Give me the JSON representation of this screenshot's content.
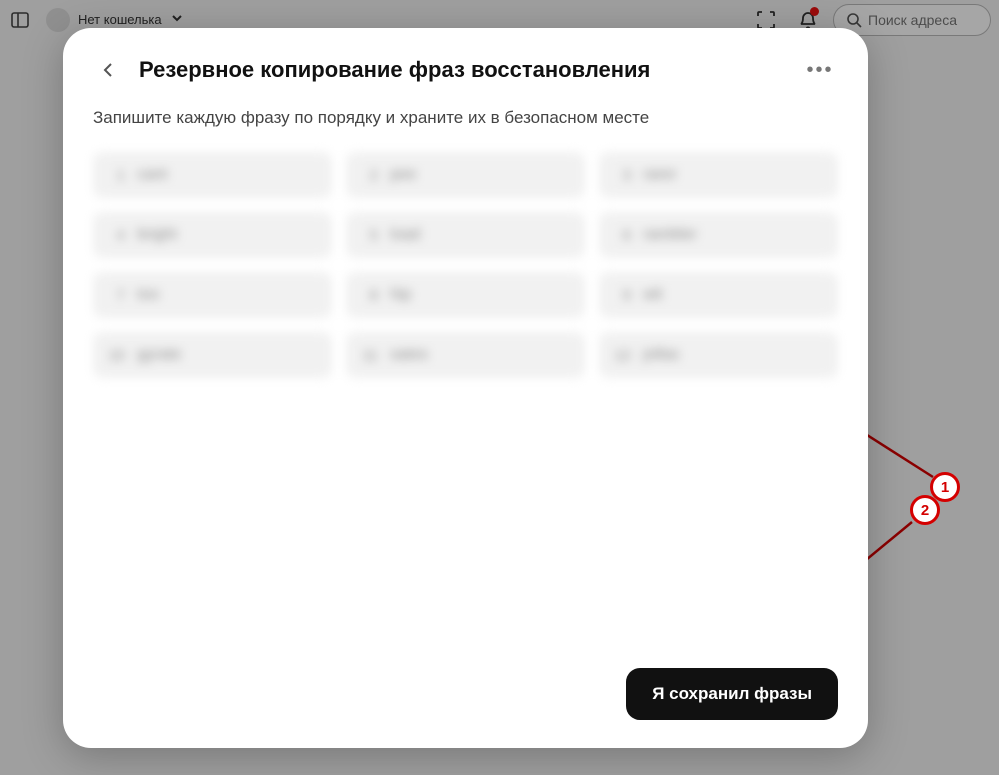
{
  "topbar": {
    "wallet_label": "Нет кошелька",
    "search_placeholder": "Поиск адреса"
  },
  "modal": {
    "title": "Резервное копирование фраз восстановления",
    "subtitle": "Запишите каждую фразу по порядку и храните их в безопасном месте",
    "confirm_label": "Я сохранил фразы",
    "phrases": [
      {
        "idx": "1",
        "word": "cant"
      },
      {
        "idx": "2",
        "word": "pee"
      },
      {
        "idx": "3",
        "word": "rarer"
      },
      {
        "idx": "4",
        "word": "bright"
      },
      {
        "idx": "5",
        "word": "load"
      },
      {
        "idx": "6",
        "word": "rambler"
      },
      {
        "idx": "7",
        "word": "too"
      },
      {
        "idx": "8",
        "word": "hip"
      },
      {
        "idx": "9",
        "word": "wit"
      },
      {
        "idx": "10",
        "word": "gyrate"
      },
      {
        "idx": "11",
        "word": "sates"
      },
      {
        "idx": "12",
        "word": "jollas"
      }
    ]
  },
  "annotations": {
    "a1": "1",
    "a2": "2"
  }
}
